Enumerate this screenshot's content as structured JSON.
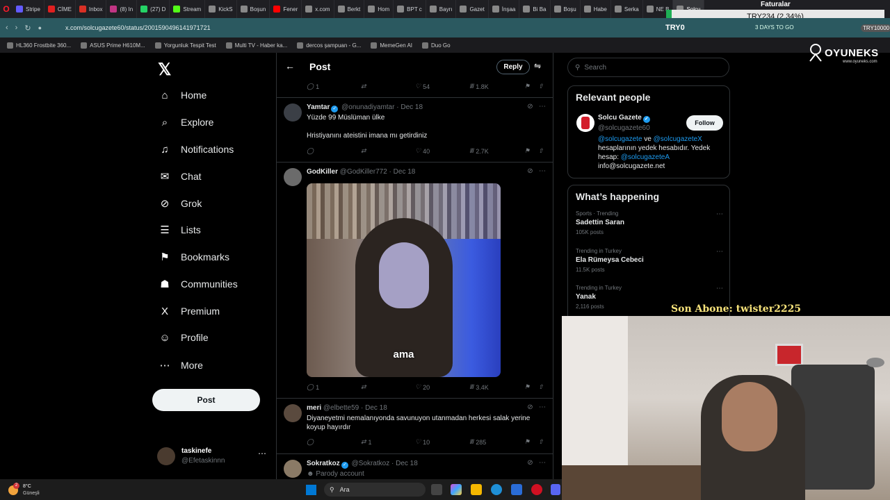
{
  "browser": {
    "tabs": [
      {
        "label": "Stripe",
        "color": "#635bff"
      },
      {
        "label": "CİME",
        "color": "#e02020"
      },
      {
        "label": "Inbox",
        "color": "#d93025"
      },
      {
        "label": "(8) In",
        "color": "#c13584"
      },
      {
        "label": "(27) D",
        "color": "#25d366"
      },
      {
        "label": "Stream",
        "color": "#53fc18"
      },
      {
        "label": "KickS",
        "color": "#888888"
      },
      {
        "label": "Boşun",
        "color": "#888888"
      },
      {
        "label": "Fener",
        "color": "#ff0000"
      },
      {
        "label": "x.com",
        "color": "#888888"
      },
      {
        "label": "Berkt",
        "color": "#888888"
      },
      {
        "label": "Hom",
        "color": "#888888"
      },
      {
        "label": "BPT c",
        "color": "#888888"
      },
      {
        "label": "Bayrı",
        "color": "#888888"
      },
      {
        "label": "Gazet",
        "color": "#888888"
      },
      {
        "label": "İnşaa",
        "color": "#888888"
      },
      {
        "label": "Bi Ba",
        "color": "#888888"
      },
      {
        "label": "Boşu",
        "color": "#888888"
      },
      {
        "label": "Habe",
        "color": "#888888"
      },
      {
        "label": "Serka",
        "color": "#888888"
      },
      {
        "label": "NE B",
        "color": "#888888"
      },
      {
        "label": "Solcu",
        "color": "#888888",
        "active": true
      }
    ],
    "url": "x.com/solcugazete60/status/2001590496141971721",
    "bookmarks": [
      "HL360 Frostbite 360...",
      "ASUS Prime H610M...",
      "Yorgunluk Tespit Test",
      "Multi TV - Haber ka...",
      "dercos şampuan - G...",
      "MemeGen AI",
      "Duo Go"
    ]
  },
  "overlay": {
    "faturalar": "Faturalar",
    "try_amount": "TRY234 (2.34%)",
    "try_zero": "TRY0",
    "days": "3 DAYS TO GO",
    "try_right": "TRY10000",
    "brand": "OYUNEKS",
    "brand_sub": "www.oyuneks.com",
    "son_abone": "Son Abone: twister2225"
  },
  "nav": {
    "items": [
      {
        "label": "Home",
        "icon": "⌂"
      },
      {
        "label": "Explore",
        "icon": "⌕"
      },
      {
        "label": "Notifications",
        "icon": "♫"
      },
      {
        "label": "Chat",
        "icon": "✉"
      },
      {
        "label": "Grok",
        "icon": "⊘"
      },
      {
        "label": "Lists",
        "icon": "☰"
      },
      {
        "label": "Bookmarks",
        "icon": "⚑"
      },
      {
        "label": "Communities",
        "icon": "☗"
      },
      {
        "label": "Premium",
        "icon": "X"
      },
      {
        "label": "Profile",
        "icon": "☺"
      },
      {
        "label": "More",
        "icon": "⋯"
      }
    ],
    "post_label": "Post",
    "account_name": "taskinefe",
    "account_handle": "@Efetaskinnn"
  },
  "main": {
    "title": "Post",
    "reply_label": "Reply",
    "top_actions": {
      "replies": "1",
      "likes": "54",
      "views": "1.8K"
    },
    "tweets": [
      {
        "name": "Yamtar",
        "handle": "@onunadiyamtar",
        "date": "Dec 18",
        "text_lines": [
          "Yüzde 99 Müslüman ülke",
          "",
          "Hristiyanını ateistini imana mı getirdiniz"
        ],
        "replies": "",
        "reposts": "",
        "likes": "40",
        "views": "2.7K"
      },
      {
        "name": "GodKiller",
        "handle": "@GodKiller772",
        "date": "Dec 18",
        "media_caption": "ama",
        "replies": "1",
        "reposts": "",
        "likes": "20",
        "views": "3.4K"
      },
      {
        "name": "meri",
        "handle": "@elbette59",
        "date": "Dec 18",
        "text_lines": [
          "Diyaneyetmi nemalanıyonda savunuyon utanmadan herkesi salak yerine",
          "koyup hayırdır"
        ],
        "replies": "",
        "reposts": "1",
        "likes": "10",
        "views": "285"
      },
      {
        "name": "Sokratkoz",
        "handle": "@Sokratkoz",
        "date": "Dec 18",
        "text_lines": [
          "Parody account"
        ]
      }
    ]
  },
  "right": {
    "search_placeholder": "Search",
    "relevant_title": "Relevant people",
    "person_name": "Solcu Gazete",
    "person_handle": "@solcugazete60",
    "follow_label": "Follow",
    "bio_link1": "@solcugazete",
    "bio_and": " ve ",
    "bio_link2": "@solcugazeteX",
    "bio_text": " hesaplarının yedek hesabıdır. Yedek hesap: ",
    "bio_link3": "@solcugazeteA",
    "bio_email": "info@solcugazete.net",
    "happening_title": "What’s happening",
    "trends": [
      {
        "category": "Sports · Trending",
        "title": "Sadettin Saran",
        "count": "105K posts"
      },
      {
        "category": "Trending in Turkey",
        "title": "Ela Rümeysa Cebeci",
        "count": "11.5K posts"
      },
      {
        "category": "Trending in Turkey",
        "title": "Yanak",
        "count": "2,116 posts"
      }
    ]
  },
  "taskbar": {
    "temp": "8°C",
    "location": "Güneşli",
    "weather_badge": "2",
    "search_label": "Ara"
  }
}
